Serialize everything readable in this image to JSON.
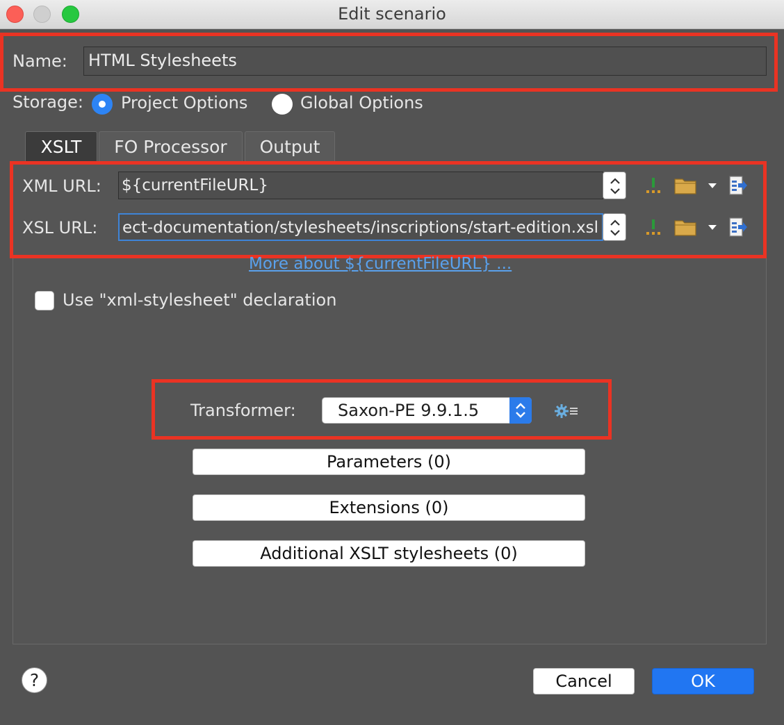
{
  "window": {
    "title": "Edit scenario"
  },
  "name": {
    "label": "Name:",
    "value": "HTML Stylesheets"
  },
  "storage": {
    "label": "Storage:",
    "options": [
      {
        "label": "Project Options",
        "selected": true
      },
      {
        "label": "Global Options",
        "selected": false
      }
    ]
  },
  "tabs": [
    {
      "label": "XSLT",
      "active": true
    },
    {
      "label": "FO Processor",
      "active": false
    },
    {
      "label": "Output",
      "active": false
    }
  ],
  "xml_url": {
    "label": "XML URL:",
    "value": "${currentFileURL}"
  },
  "xsl_url": {
    "label": "XSL URL:",
    "value": "ect-documentation/stylesheets/inscriptions/start-edition.xsl"
  },
  "more_link": "More about ${currentFileURL} ...",
  "use_declaration": {
    "label": "Use \"xml-stylesheet\" declaration",
    "checked": false
  },
  "transformer": {
    "label": "Transformer:",
    "value": "Saxon-PE 9.9.1.5"
  },
  "buttons": {
    "parameters": "Parameters (0)",
    "extensions": "Extensions (0)",
    "additional": "Additional XSLT stylesheets (0)",
    "cancel": "Cancel",
    "ok": "OK",
    "help": "?"
  },
  "colors": {
    "accent": "#2176f2",
    "highlight": "#ea3323",
    "link": "#5aa1ec"
  }
}
